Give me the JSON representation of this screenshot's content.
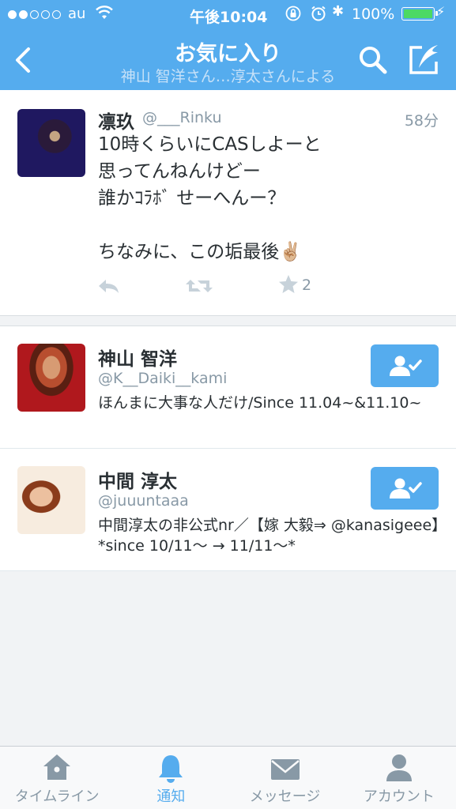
{
  "status_bar": {
    "carrier": "au",
    "time": "午後10:04",
    "battery_percent": "100%",
    "signal_bars": 2,
    "battery_level": 1.0
  },
  "nav": {
    "title": "お気に入り",
    "subtitle": "神山 智洋さん…淳太さんによる"
  },
  "tweet": {
    "name": "凛玖",
    "handle": "@___Rinku",
    "time": "58分",
    "lines": [
      "10時くらいにCASしよーと",
      "思ってんねんけどー",
      "誰かｺﾗﾎﾞ せーへんー？",
      "ちなみに、この垢最後✌🏼"
    ],
    "favorite_count": "2"
  },
  "users": [
    {
      "name": "神山 智洋",
      "handle": "@K__Daiki__kami",
      "bio": "ほんまに大事な人だけ/Since 11.04~&11.10~"
    },
    {
      "name": "中間 淳太",
      "handle": "@juuuntaaa",
      "bio": "中間淳太の非公式nr／【嫁 大毅⇒ @kanasigeee】*since 10/11～ → 11/11～*"
    }
  ],
  "tabs": [
    {
      "label": "タイムライン",
      "icon": "home-icon",
      "active": false
    },
    {
      "label": "通知",
      "icon": "bell-icon",
      "active": true
    },
    {
      "label": "メッセージ",
      "icon": "envelope-icon",
      "active": false
    },
    {
      "label": "アカウント",
      "icon": "person-icon",
      "active": false
    }
  ],
  "colors": {
    "brand": "#55acee",
    "secondary_text": "#8899a6",
    "battery": "#4cd964"
  }
}
